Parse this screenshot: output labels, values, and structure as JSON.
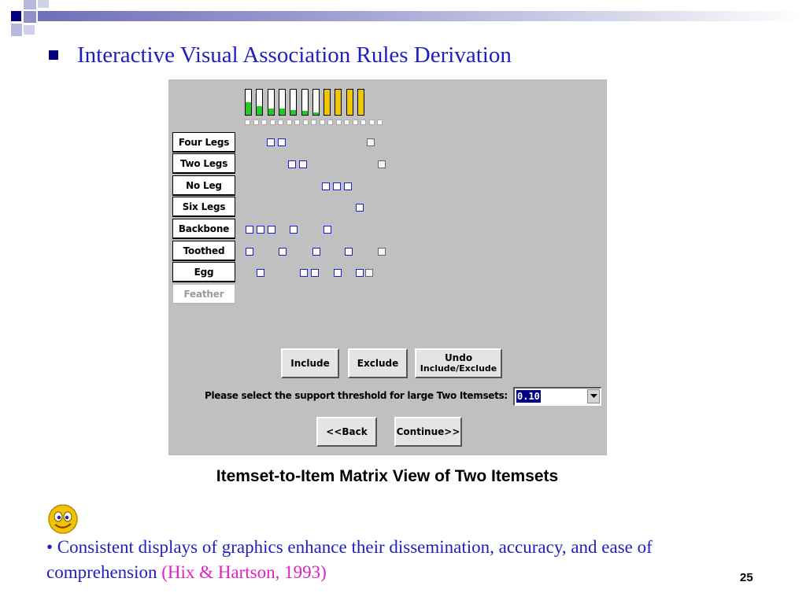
{
  "slide": {
    "title": "Interactive Visual Association Rules Derivation",
    "caption": "Itemset-to-Item Matrix View of Two Itemsets",
    "body_text": "• Consistent displays of graphics enhance their dissemination, accuracy, and ease of comprehension",
    "citation": "(Hix & Hartson, 1993)",
    "page_number": "25",
    "colors": {
      "title": "#1f1fbf",
      "citation": "#e020c0",
      "bar_green": "#22cc22",
      "bar_yellow": "#f0c800",
      "cell_blue": "#1c1cd4"
    }
  },
  "app": {
    "support_bars": [
      {
        "level": 0.5,
        "color": "green"
      },
      {
        "level": 0.35,
        "color": "green"
      },
      {
        "level": 0.25,
        "color": "green"
      },
      {
        "level": 0.25,
        "color": "green"
      },
      {
        "level": 0.2,
        "color": "green"
      },
      {
        "level": 0.15,
        "color": "green"
      },
      {
        "level": 0.1,
        "color": "green"
      },
      {
        "level": 1.0,
        "color": "yellow"
      },
      {
        "level": 1.0,
        "color": "yellow"
      },
      {
        "level": 1.0,
        "color": "yellow"
      },
      {
        "level": 1.0,
        "color": "yellow"
      }
    ],
    "items": [
      {
        "label": "Four Legs",
        "enabled": true
      },
      {
        "label": "Two Legs",
        "enabled": true
      },
      {
        "label": "No Leg",
        "enabled": true
      },
      {
        "label": "Six Legs",
        "enabled": true
      },
      {
        "label": "Backbone",
        "enabled": true
      },
      {
        "label": "Toothed",
        "enabled": true
      },
      {
        "label": "Egg",
        "enabled": true
      },
      {
        "label": "Feather",
        "enabled": false
      }
    ],
    "buttons": {
      "include": "Include",
      "exclude": "Exclude",
      "undo_line1": "Undo",
      "undo_line2": "Include/Exclude",
      "back": "<<Back",
      "continue": "Continue>>"
    },
    "threshold": {
      "prompt": "Please select the support threshold for large Two Itemsets:",
      "value": "0.10"
    },
    "icons": {
      "dropdown": "chevron-down-icon",
      "emoji": "smiley-face-icon"
    }
  }
}
